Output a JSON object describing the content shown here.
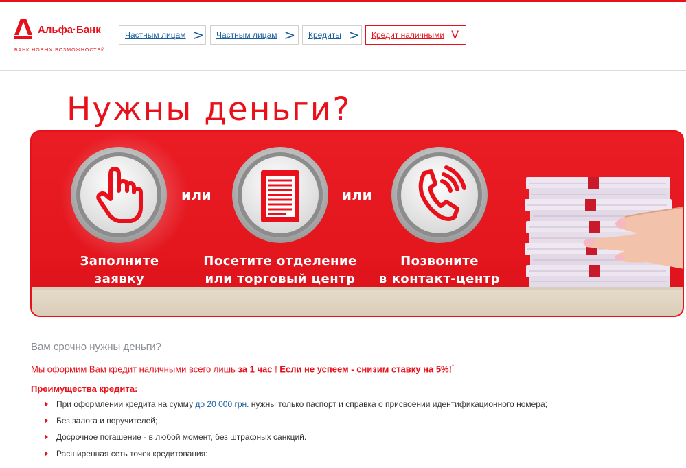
{
  "brand": {
    "name": "Альфа·Банк",
    "tagline": "БАНК НОВЫХ ВОЗМОЖНОСТЕЙ",
    "accent": "#e8111b",
    "link_color": "#1a5f9e"
  },
  "breadcrumb": [
    {
      "label": "Частным лицам",
      "arrow": ">",
      "active": false
    },
    {
      "label": "Частным лицам",
      "arrow": ">",
      "active": false
    },
    {
      "label": "Кредиты",
      "arrow": ">",
      "active": false
    },
    {
      "label": "Кредит наличными",
      "arrow": "V",
      "active": true
    }
  ],
  "hero": {
    "title": "Нужны деньги?",
    "or_text": "или",
    "options": [
      {
        "icon": "hand-pointer-icon",
        "line1": "Заполните",
        "line2": "заявку"
      },
      {
        "icon": "document-icon",
        "line1": "Посетите отделение",
        "line2": "или торговый центр"
      },
      {
        "icon": "phone-icon",
        "line1": "Позвоните",
        "line2": "в контакт-центр"
      }
    ]
  },
  "content": {
    "question": "Вам срочно нужны деньги?",
    "offer_prefix": "Мы оформим Вам кредит наличными всего лишь ",
    "offer_time": "за 1 час",
    "offer_middle": " ! ",
    "offer_promise": "Если не успеем - снизим ставку на 5%!",
    "offer_mark": "*",
    "advantages_title": "Преимущества кредита:",
    "advantages": [
      {
        "before": "При оформлении кредита на сумму ",
        "link": "до 20 000 грн.",
        "after": " нужны только паспорт и справка о присвоении идентификационного номера;"
      },
      {
        "before": "Без залога и поручителей;",
        "link": "",
        "after": ""
      },
      {
        "before": "Досрочное погашение - в любой момент, без штрафных санкций.",
        "link": "",
        "after": ""
      },
      {
        "before": "Расширенная сеть точек кредитования:",
        "link": "",
        "after": ""
      }
    ]
  }
}
